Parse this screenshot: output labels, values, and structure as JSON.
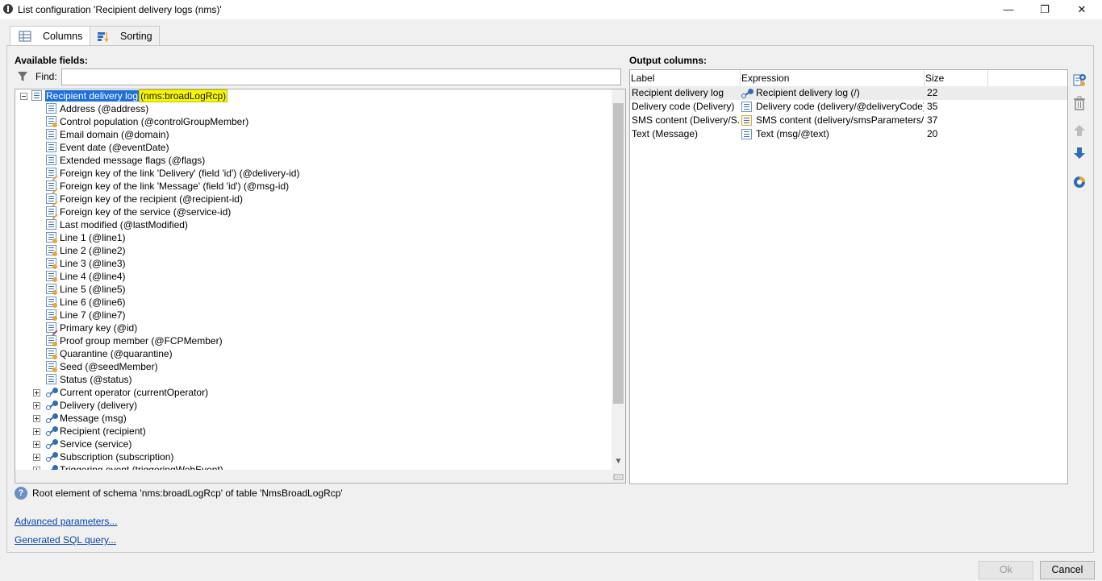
{
  "window": {
    "title": "List configuration 'Recipient delivery logs (nms)'",
    "controls": {
      "minimize": "—",
      "restore": "❐",
      "close": "✕"
    }
  },
  "tabs": [
    {
      "label": "Columns",
      "icon": "table-icon",
      "active": true
    },
    {
      "label": "Sorting",
      "icon": "sort-icon",
      "active": false
    }
  ],
  "available": {
    "title": "Available fields:",
    "find_label": "Find:",
    "find_value": "",
    "root": {
      "label": "Recipient delivery log",
      "schema": "(nms:broadLogRcp)"
    },
    "fields": [
      {
        "label": "Address (@address)",
        "icon": "text"
      },
      {
        "label": "Control population (@controlGroupMember)",
        "icon": "num"
      },
      {
        "label": "Email domain (@domain)",
        "icon": "text"
      },
      {
        "label": "Event date (@eventDate)",
        "icon": "text"
      },
      {
        "label": "Extended message flags (@flags)",
        "icon": "text"
      },
      {
        "label": "Foreign key of the link 'Delivery' (field 'id') (@delivery-id)",
        "icon": "key"
      },
      {
        "label": "Foreign key of the link 'Message' (field 'id') (@msg-id)",
        "icon": "key"
      },
      {
        "label": "Foreign key of the recipient (@recipient-id)",
        "icon": "key"
      },
      {
        "label": "Foreign key of the service (@service-id)",
        "icon": "key"
      },
      {
        "label": "Last modified (@lastModified)",
        "icon": "text"
      },
      {
        "label": "Line 1 (@line1)",
        "icon": "num"
      },
      {
        "label": "Line 2 (@line2)",
        "icon": "num"
      },
      {
        "label": "Line 3 (@line3)",
        "icon": "num"
      },
      {
        "label": "Line 4 (@line4)",
        "icon": "num"
      },
      {
        "label": "Line 5 (@line5)",
        "icon": "num"
      },
      {
        "label": "Line 6 (@line6)",
        "icon": "num"
      },
      {
        "label": "Line 7 (@line7)",
        "icon": "num"
      },
      {
        "label": "Primary key (@id)",
        "icon": "pk"
      },
      {
        "label": "Proof group member (@FCPMember)",
        "icon": "num"
      },
      {
        "label": "Quarantine (@quarantine)",
        "icon": "num"
      },
      {
        "label": "Seed (@seedMember)",
        "icon": "num"
      },
      {
        "label": "Status (@status)",
        "icon": "text"
      }
    ],
    "links": [
      {
        "label": "Current operator (currentOperator)"
      },
      {
        "label": "Delivery (delivery)"
      },
      {
        "label": "Message (msg)"
      },
      {
        "label": "Recipient (recipient)"
      },
      {
        "label": "Service (service)"
      },
      {
        "label": "Subscription (subscription)"
      },
      {
        "label": "Triggering event (triggeringWebEvent)"
      }
    ],
    "info": "Root element of schema 'nms:broadLogRcp' of table 'NmsBroadLogRcp'"
  },
  "output": {
    "title": "Output columns:",
    "headers": {
      "label": "Label",
      "expression": "Expression",
      "size": "Size"
    },
    "rows": [
      {
        "label": "Recipient delivery log",
        "expression": "Recipient delivery log (/)",
        "size": "22",
        "icon": "link"
      },
      {
        "label": "Delivery code (Delivery)",
        "expression": "Delivery code (delivery/@deliveryCode)",
        "size": "35",
        "icon": "text"
      },
      {
        "label": "SMS content (Delivery/S...",
        "expression": "SMS content (delivery/smsParameters/s",
        "size": "37",
        "icon": "memo"
      },
      {
        "label": "Text (Message)",
        "expression": "Text (msg/@text)",
        "size": "20",
        "icon": "text"
      }
    ]
  },
  "links": {
    "advanced": "Advanced parameters...",
    "sql": "Generated SQL query..."
  },
  "buttons": {
    "ok": "Ok",
    "cancel": "Cancel"
  }
}
